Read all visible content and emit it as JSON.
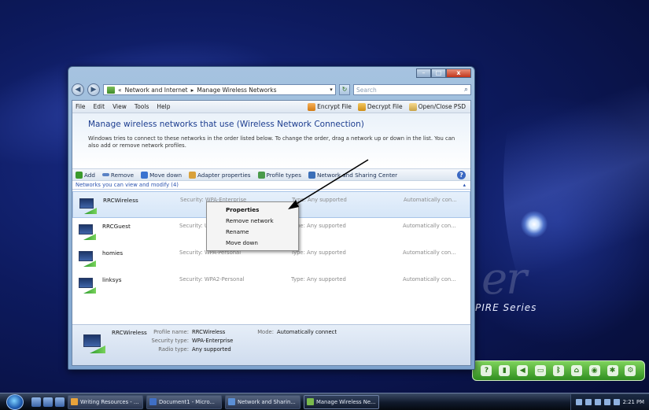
{
  "window": {
    "caption": {
      "min": "–",
      "max": "□",
      "close": "x"
    },
    "back": "◀",
    "forward": "▶",
    "breadcrumb": [
      "«",
      "Network and Internet",
      "▸",
      "Manage Wireless Networks"
    ],
    "search_placeholder": "Search"
  },
  "menubar": {
    "items": [
      "File",
      "Edit",
      "View",
      "Tools",
      "Help"
    ],
    "right": [
      "Encrypt File",
      "Decrypt File",
      "Open/Close PSD"
    ]
  },
  "banner": {
    "title": "Manage wireless networks that use (Wireless Network Connection)",
    "description": "Windows tries to connect to these networks in the order listed below. To change the order, drag a network up or down in the list. You can also add or remove network profiles."
  },
  "toolbar": {
    "items": [
      "Add",
      "Remove",
      "Move down",
      "Adapter properties",
      "Profile types",
      "Network and Sharing Center"
    ],
    "help": "?"
  },
  "group_header": "Networks you can view and modify (4)",
  "networks": [
    {
      "name": "RRCWireless",
      "security": "Security: WPA-Enterprise",
      "type": "Type: Any supported",
      "mode": "Automatically con..."
    },
    {
      "name": "RRCGuest",
      "security": "Security: U",
      "type": "Type: Any supported",
      "mode": "Automatically con..."
    },
    {
      "name": "homies",
      "security": "Security: WPA-Personal",
      "type": "Type: Any supported",
      "mode": "Automatically con..."
    },
    {
      "name": "linksys",
      "security": "Security: WPA2-Personal",
      "type": "Type: Any supported",
      "mode": "Automatically con..."
    }
  ],
  "context_menu": [
    "Properties",
    "Remove network",
    "Rename",
    "Move down"
  ],
  "details": {
    "name": "RRCWireless",
    "profile_label": "Profile name:",
    "profile_value": "RRCWireless",
    "security_label": "Security type:",
    "security_value": "WPA-Enterprise",
    "radio_label": "Radio type:",
    "radio_value": "Any supported",
    "mode_label": "Mode:",
    "mode_value": "Automatically connect"
  },
  "wallpaper": {
    "brand": "er",
    "series": "PIRE Series"
  },
  "taskbar": {
    "buttons": [
      "Writing Resources - ...",
      "Document1 - Micro...",
      "Network and Sharin...",
      "Manage Wireless Ne..."
    ],
    "clock": "2:21 PM"
  }
}
